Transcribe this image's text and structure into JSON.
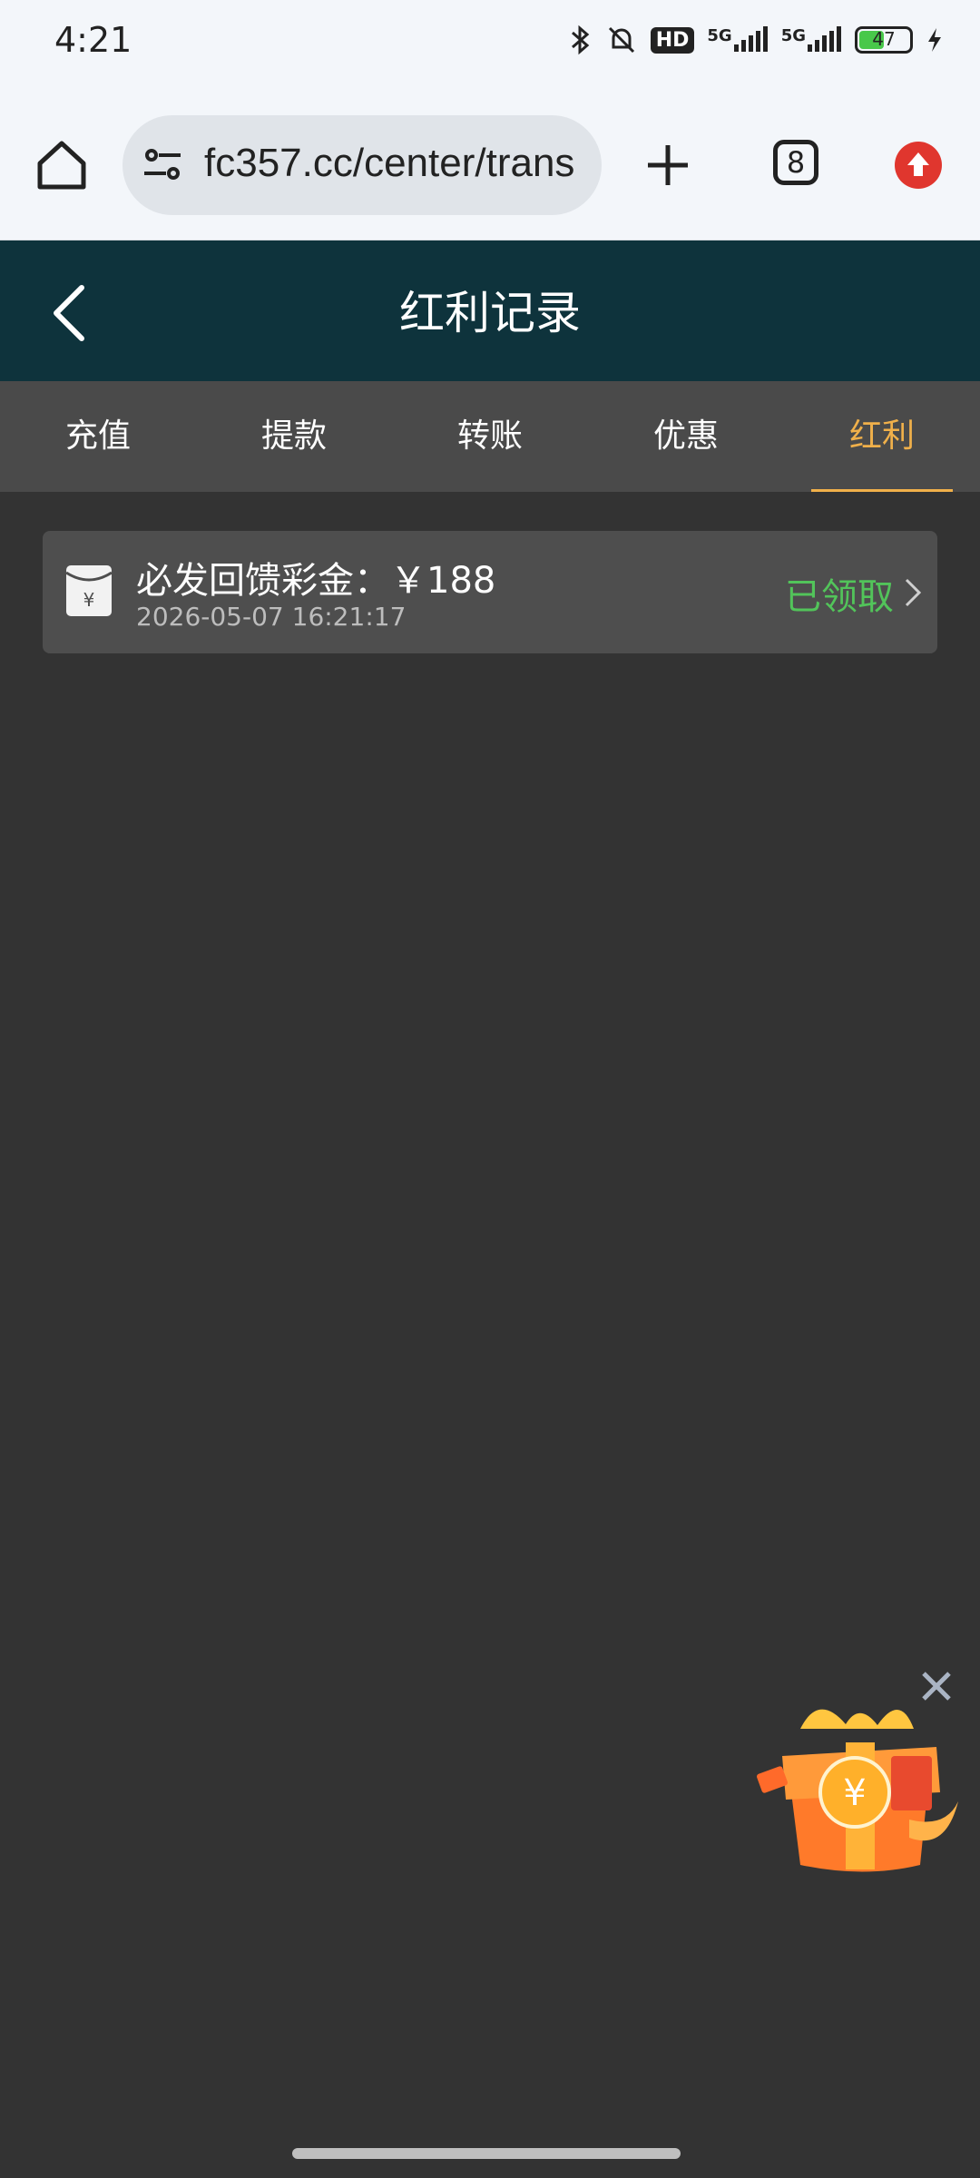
{
  "status_bar": {
    "time": "4:21",
    "hd_label": "HD",
    "network_1": "5G",
    "network_2": "5G",
    "battery_level": "47"
  },
  "browser": {
    "url": "fc357.cc/center/trans",
    "tab_count": "8"
  },
  "header": {
    "title": "红利记录"
  },
  "tabs": [
    {
      "label": "充值"
    },
    {
      "label": "提款"
    },
    {
      "label": "转账"
    },
    {
      "label": "优惠"
    },
    {
      "label": "红利"
    }
  ],
  "active_tab": 4,
  "records": [
    {
      "title": "必发回馈彩金：￥188",
      "time": "2026-05-07 16:21:17",
      "status": "已领取"
    }
  ],
  "colors": {
    "header_bg": "#0e333c",
    "active_tab": "#f0b04a",
    "status_claimed": "#52c45a"
  }
}
